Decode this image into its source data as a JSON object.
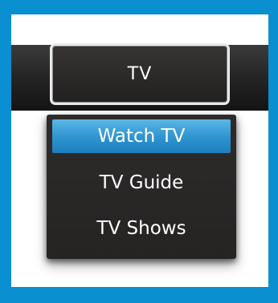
{
  "tv_button": {
    "label": "TV"
  },
  "menu": {
    "items": [
      {
        "label": "Watch TV",
        "selected": true
      },
      {
        "label": "TV Guide",
        "selected": false
      },
      {
        "label": "TV Shows",
        "selected": false
      }
    ]
  },
  "colors": {
    "frame_border": "#0a8fd1",
    "selected_highlight": "#2e93cf",
    "menu_background": "#2b2828",
    "text": "#ffffff"
  }
}
